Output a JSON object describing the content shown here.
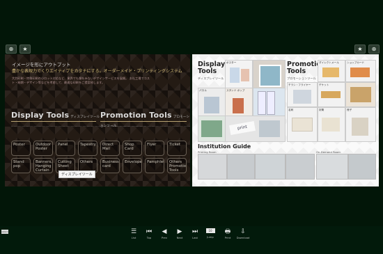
{
  "left_page": {
    "headline": "イメージを形にアウトプット",
    "subheadline": "豊かな表現力でくりエイティブをカタチにする。オーダーメイド・プリンティングシステム",
    "intro": "大判印刷・特殊印刷の小ロット対応など、業界でも類をみないデザインサービスを展開。 お社工場でコスト・納期・デザイン等などを考慮して、最適な印刷をご提案致します。",
    "display_tools_title": "Display Tools",
    "display_tools_sub": "ディスプレイツール",
    "promotion_tools_title": "Promotion Tools",
    "promotion_tools_sub": "プロモーションツール",
    "display_items": [
      "Poster",
      "Outdoor Poster",
      "Panel",
      "Tapestry",
      "Stand pop",
      "Banners, Hanging Curtain",
      "Cutting Sheet",
      "Others"
    ],
    "promotion_items": [
      "Direct Mail",
      "Shop Card",
      "Flyer",
      "Ticket",
      "Business card",
      "Envelope",
      "Pamphlet",
      "Others Promotion Tools"
    ],
    "tooltip": "ディスプレイツール"
  },
  "right_page": {
    "display_title": "Display Tools",
    "display_sub": "ディスプレイツール",
    "promotion_title": "Promotion Tools",
    "promotion_sub": "プロモーションツール",
    "display_thumb_labels": [
      "ポスター",
      "",
      "パネル",
      "スタンド ポップ",
      "",
      "",
      ""
    ],
    "promotion_thumb_labels": [
      "ダイレクトメール",
      "ショップカード",
      "チラシ・フライヤー",
      "チケット",
      "名刺",
      "",
      "封筒",
      "冊子",
      "",
      ""
    ],
    "institution_title": "Institution Guide",
    "printing_room": "Printing Room",
    "on_demand_room": "On-Demand Room"
  },
  "toolbar": {
    "logo": "saison",
    "page_number": "10",
    "buttons": [
      {
        "icon": "☰",
        "label": "List"
      },
      {
        "icon": "⏮",
        "label": "Top"
      },
      {
        "icon": "◀",
        "label": "Prev"
      },
      {
        "icon": "▶",
        "label": "Next"
      },
      {
        "icon": "⏭",
        "label": "Last"
      },
      {
        "icon": "",
        "label": "Jump"
      },
      {
        "icon": "🖶",
        "label": "Print"
      },
      {
        "icon": "⇩",
        "label": "Download"
      }
    ]
  },
  "zoom": {
    "zoom_symbol": "⊕",
    "bookmark_symbol": "★"
  },
  "colors": {
    "background": "#021608",
    "accent": "#d9c087"
  }
}
